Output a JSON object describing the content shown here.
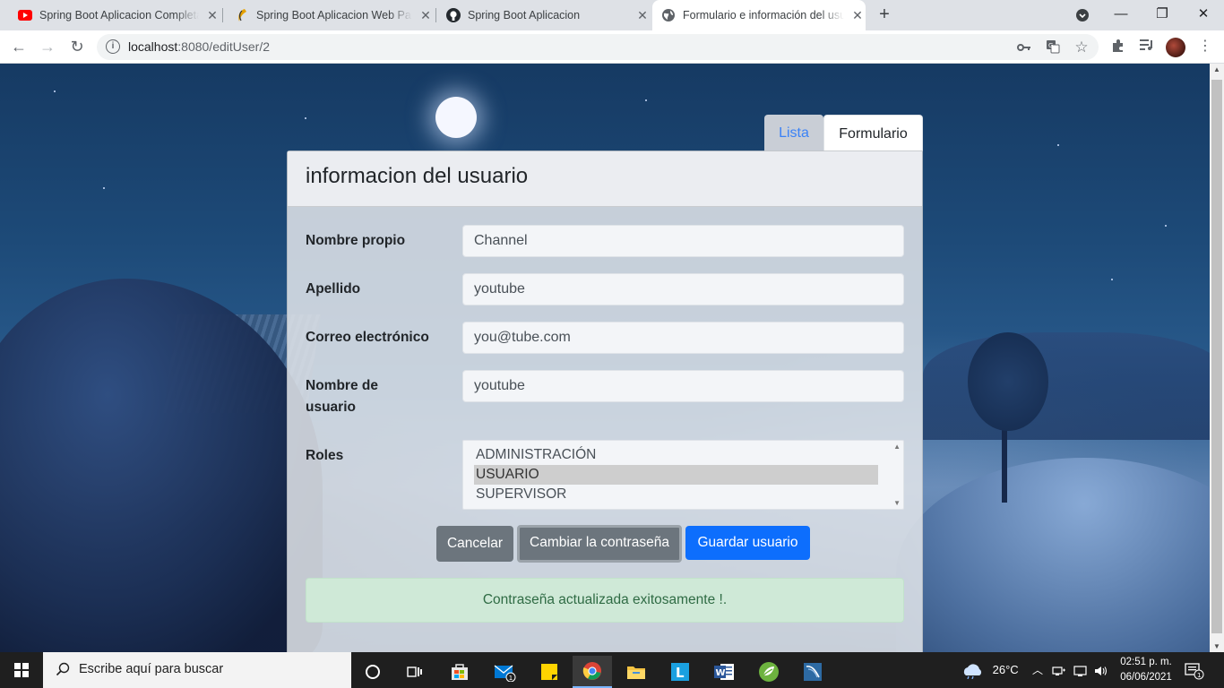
{
  "browser": {
    "tabs": [
      {
        "title": "Spring Boot Aplicacion Completa",
        "icon": "youtube-icon",
        "active": false
      },
      {
        "title": "Spring Boot Aplicacion Web Parte",
        "icon": "app-icon",
        "active": false
      },
      {
        "title": "Spring Boot Aplicacion",
        "icon": "github-icon",
        "active": false
      },
      {
        "title": "Formulario e información del usuario",
        "icon": "globe-icon",
        "active": true
      }
    ],
    "new_tab": "+",
    "url_host": "localhost",
    "url_rest": ":8080/editUser/2"
  },
  "page": {
    "nav_tabs": {
      "lista": "Lista",
      "formulario": "Formulario"
    },
    "card_title": "informacion del usuario",
    "fields": {
      "nombre": {
        "label": "Nombre propio",
        "value": "Channel"
      },
      "apellido": {
        "label": "Apellido",
        "value": "youtube"
      },
      "correo": {
        "label": "Correo electrónico",
        "value": "you@tube.com"
      },
      "usuario": {
        "label_line1": "Nombre de",
        "label_line2": "usuario",
        "value": "youtube"
      },
      "roles": {
        "label": "Roles",
        "options": [
          "ADMINISTRACIÓN",
          "USUARIO",
          "SUPERVISOR"
        ],
        "selected": "USUARIO"
      }
    },
    "buttons": {
      "cancel": "Cancelar",
      "change_password": "Cambiar la contraseña",
      "save": "Guardar usuario"
    },
    "alert": "Contraseña actualizada exitosamente !.",
    "colors": {
      "primary": "#0d6efd",
      "secondary": "#6c757d",
      "success_bg": "#cfe9d7",
      "success_text": "#2f6b44"
    }
  },
  "taskbar": {
    "search_placeholder": "Escribe aquí para buscar",
    "mail_badge": "1",
    "weather": "26°C",
    "time": "02:51 p. m.",
    "date": "06/06/2021",
    "notification_badge": "1"
  }
}
